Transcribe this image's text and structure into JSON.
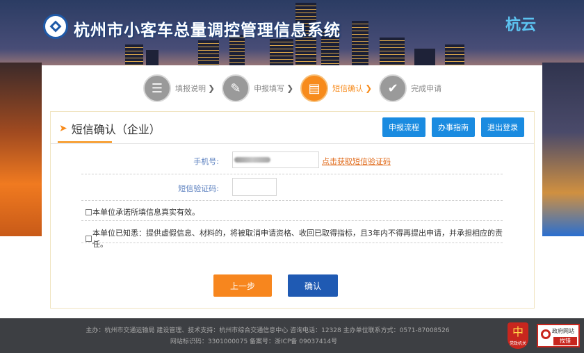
{
  "header": {
    "site_title": "杭州市小客车总量调控管理信息系统",
    "emblem_text": "杭云"
  },
  "steps": [
    {
      "label": "填报说明",
      "icon": "document-icon",
      "active": false
    },
    {
      "label": "申报填写",
      "icon": "edit-icon",
      "active": false
    },
    {
      "label": "短信确认",
      "icon": "message-icon",
      "active": true
    },
    {
      "label": "完成申请",
      "icon": "check-icon",
      "active": false
    }
  ],
  "panel": {
    "title": "短信确认（企业）",
    "buttons": {
      "process": "申报流程",
      "guide": "办事指南",
      "logout": "退出登录"
    }
  },
  "form": {
    "phone_label": "手机号:",
    "phone_value": "",
    "get_code_link": "点击获取短信验证码",
    "sms_label": "短信验证码:",
    "sms_value": "",
    "agree_1": "本单位承诺所填信息真实有效。",
    "agree_2": "本单位已知悉：提供虚假信息、材料的，将被取消申请资格、收回已取得指标，且3年内不得再提出申请，并承担相应的责任。"
  },
  "actions": {
    "prev": "上一步",
    "confirm": "确认"
  },
  "footer": {
    "line1": "主办：杭州市交通运输局    建设管理、技术支持：杭州市综合交通信息中心    咨询电话：12328    主办单位联系方式：0571-87008526",
    "line2": "网站标识码：3301000075    备案号：浙ICP备 09037414号",
    "badge_text": "党政机关",
    "gov_text_1": "政府网站",
    "gov_text_2": "找错"
  },
  "colors": {
    "accent_orange": "#f7861e",
    "accent_blue": "#1a8be0",
    "confirm_blue": "#1f5ab3"
  }
}
